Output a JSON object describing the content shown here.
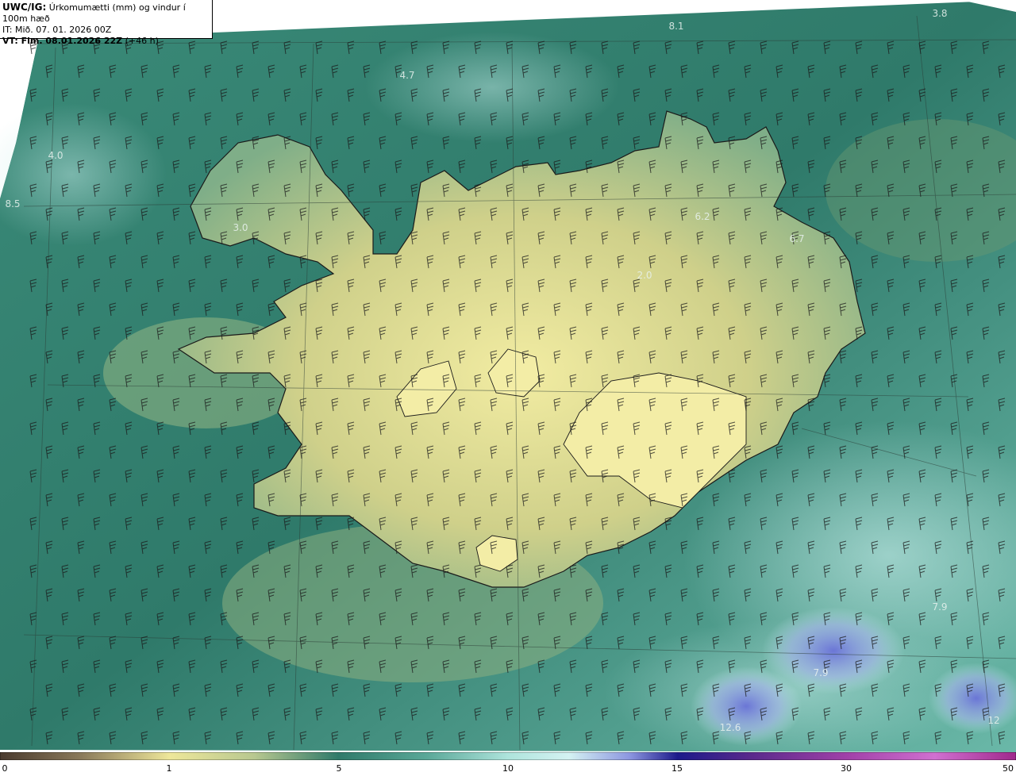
{
  "header": {
    "product": "UWC/IG:",
    "title": "Úrkomumætti (mm) og vindur í 100m hæð",
    "issue_time": "IT: Mið. 07. 01. 2026 00Z",
    "valid_prefix": "VT: Fim. 08.01.2026 22Z",
    "valid_offset": "(+46 h)"
  },
  "value_labels": [
    {
      "text": "8.1"
    },
    {
      "text": "3.8"
    },
    {
      "text": "4.7"
    },
    {
      "text": "4.0"
    },
    {
      "text": "8.5"
    },
    {
      "text": "3.0"
    },
    {
      "text": "6.2"
    },
    {
      "text": "6.7"
    },
    {
      "text": "2.0"
    },
    {
      "text": "7.9"
    },
    {
      "text": "7.9"
    },
    {
      "text": "12.6"
    },
    {
      "text": "12"
    }
  ],
  "colorbar": {
    "ticks": [
      "0",
      "1",
      "5",
      "10",
      "15",
      "30",
      "50"
    ],
    "colors": [
      "#4a3a2e",
      "#8a7a5a",
      "#d6cf8c",
      "#eee79a",
      "#8fb890",
      "#2f7a6a",
      "#3e8f80",
      "#8fd4cc",
      "#d4f2f2",
      "#aeb8f0",
      "#5c5fd0",
      "#1c1a8a",
      "#7a2c9c",
      "#d070d0",
      "#f2b8e8"
    ]
  },
  "colors": {
    "sea": "#2e7c6e",
    "land_low": "#d9d48a",
    "land_high": "#f0eaa0",
    "coast": "#1a1a1a"
  }
}
